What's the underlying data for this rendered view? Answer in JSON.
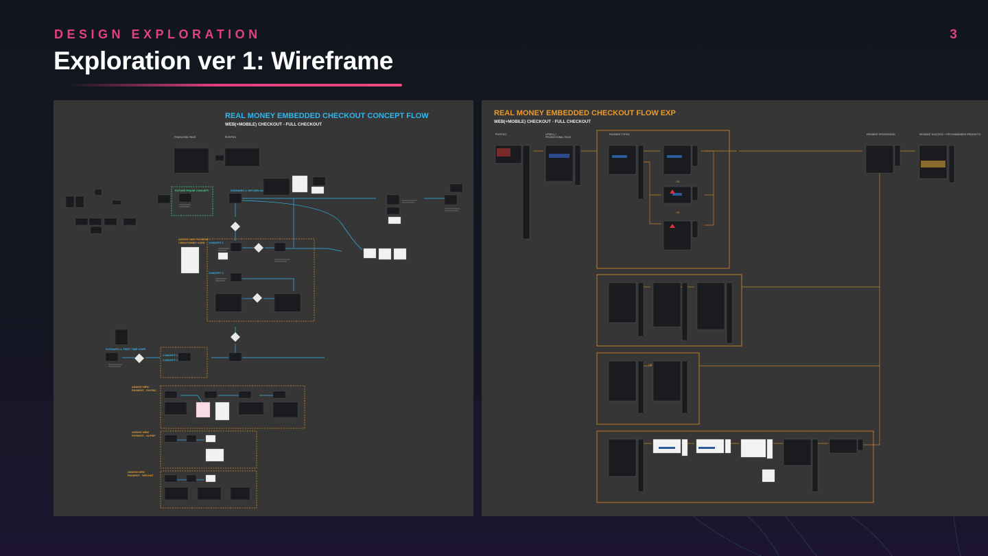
{
  "slide": {
    "eyebrow": "DESIGN EXPLORATION",
    "title": "Exploration ver 1: Wireframe",
    "page_number": "3"
  },
  "colors": {
    "accent_pink": "#e3407f",
    "accent_blue": "#2fb7ee",
    "accent_orange": "#e89a2c",
    "accent_green": "#3fd88a",
    "panel_bg": "#363636"
  },
  "left_board": {
    "title": "REAL MONEY EMBEDDED CHECKOUT CONCEPT FLOW",
    "subtitle": "WEB(+MOBILE) CHECKOUT - FULL CHECKOUT",
    "labels": {
      "franchise_page": "FRANCHISE PAGE",
      "pdp": "PDP/PDG",
      "future_phase": "FUTURE PHASE CONCEPT",
      "scenario1": "SCENARIO 1: RETURN USERS",
      "adding_payment_credit": "ADDING NEW PAYMENT - CREDIT/DEBIT CARD",
      "concept1": "CONCEPT 1",
      "concept2": "CONCEPT 2",
      "scenario2": "SCENARIO 2: FIRST TIME USER",
      "concept1b": "CONCEPT 1",
      "concept2b": "CONCEPT 2",
      "adding_paypal": "ADDING NEW PAYMENT - PAYPAL",
      "adding_alipay": "ADDING NEW PAYMENT - ALIPAY",
      "adding_wechat": "ADDING NEW PAYMENT - WECHAT"
    }
  },
  "right_board": {
    "title": "REAL MONEY EMBEDDED CHECKOUT FLOW EXP",
    "subtitle": "WEB(+MOBILE) CHECKOUT - FULL CHECKOUT",
    "labels": {
      "pdp": "PDP/PDG",
      "upsell": "UPSELL / PROMOTIONAL PAGE",
      "payment_types": "PAYMENT TYPES",
      "payment_processing": "PAYMENT PROCESSING",
      "payment_success": "PAYMENT SUCCESS + RECOMMENDED PRODUCTS",
      "or1": "OR",
      "or2": "OR",
      "or3": "OR"
    }
  }
}
